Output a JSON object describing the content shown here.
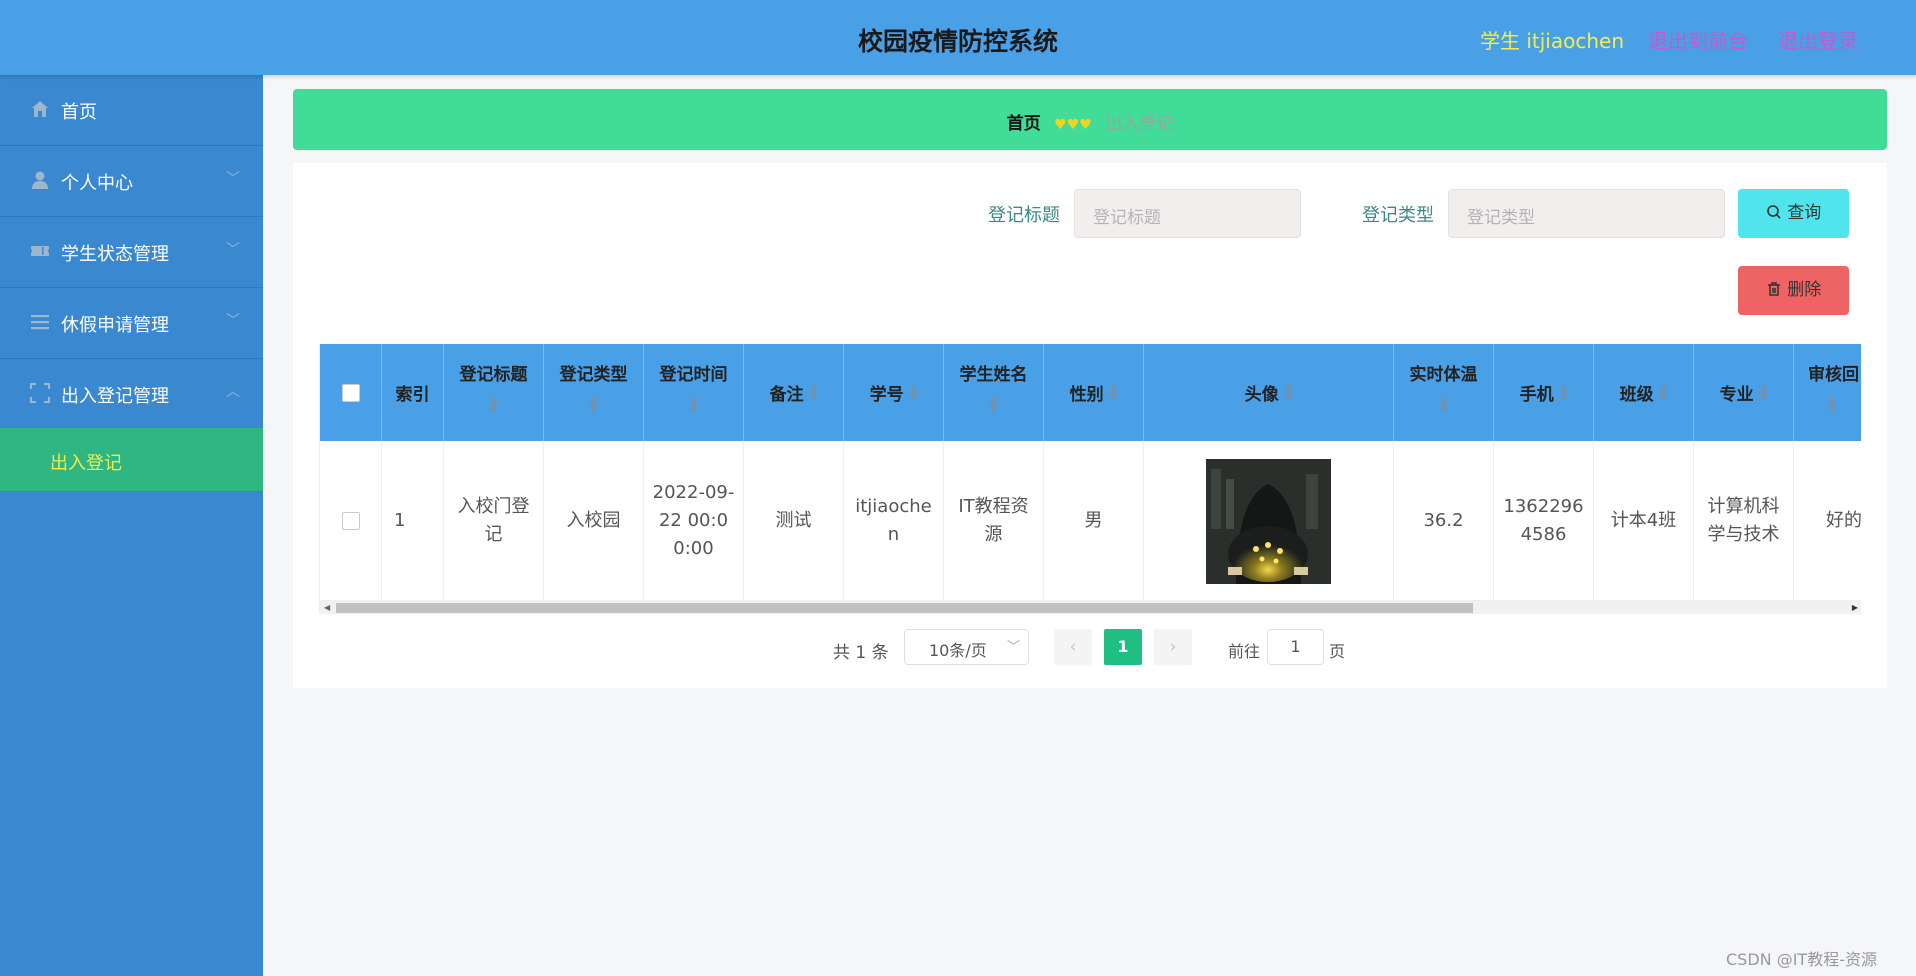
{
  "header": {
    "title": "校园疫情防控系统",
    "user": "学生 itjiaochen",
    "to_front": "退出到前台",
    "logout": "退出登录"
  },
  "sidebar": {
    "items": [
      {
        "label": "首页",
        "icon": "home-icon"
      },
      {
        "label": "个人中心",
        "icon": "user-icon"
      },
      {
        "label": "学生状态管理",
        "icon": "ticket-icon"
      },
      {
        "label": "休假申请管理",
        "icon": "list-icon"
      },
      {
        "label": "出入登记管理",
        "icon": "fullscreen-icon"
      }
    ],
    "sub_item": "出入登记"
  },
  "breadcrumb": {
    "home": "首页",
    "separator": "♥♥♥",
    "current": "出入登记"
  },
  "search": {
    "title_label": "登记标题",
    "title_placeholder": "登记标题",
    "type_label": "登记类型",
    "type_placeholder": "登记类型",
    "query_button": "查询",
    "delete_button": "删除"
  },
  "table": {
    "columns": [
      "",
      "索引",
      "登记标题",
      "登记类型",
      "登记时间",
      "备注",
      "学号",
      "学生姓名",
      "性别",
      "头像",
      "实时体温",
      "手机",
      "班级",
      "专业",
      "审核回"
    ],
    "rows": [
      {
        "index": "1",
        "title": "入校门登记",
        "type": "入校园",
        "time": "2022-09-22 00:00:00",
        "note": "测试",
        "student_no": "itjiaochen",
        "student_name": "IT教程资源",
        "gender": "男",
        "temperature": "36.2",
        "phone": "13622964586",
        "class": "计本4班",
        "major": "计算机科学与技术",
        "review": "好的"
      }
    ]
  },
  "pagination": {
    "total": "共 1 条",
    "page_size": "10条/页",
    "current_page": "1",
    "goto_label": "前往",
    "goto_value": "1",
    "page_suffix": "页"
  },
  "watermark": "CSDN @IT教程-资源",
  "colors": {
    "header": "#4aa0e6",
    "sidebar": "#3a88d0",
    "breadcrumb": "#40dc98",
    "active_menu": "#2fb682",
    "query_button": "#50e5ec",
    "delete_button": "#ee6465",
    "pager_active": "#1fbf84"
  }
}
